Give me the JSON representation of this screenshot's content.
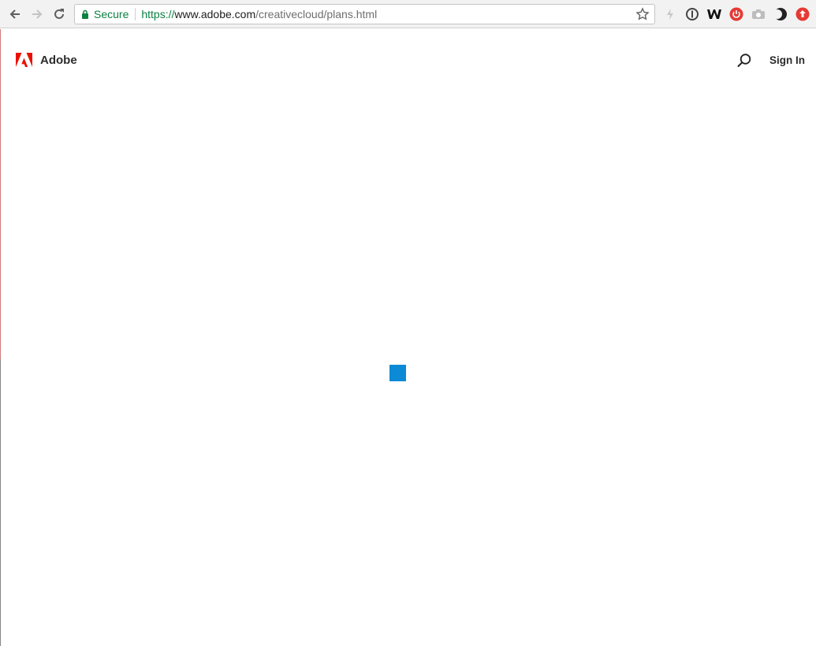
{
  "browser": {
    "secure_label": "Secure",
    "url": {
      "protocol": "https://",
      "host": "www.adobe.com",
      "path": "/creativecloud/plans.html"
    },
    "extensions": [
      "flash-icon",
      "onepassword-icon",
      "w-extension-icon",
      "power-extension-icon",
      "camera-icon",
      "dark-moon-icon",
      "upload-extension-icon"
    ]
  },
  "site": {
    "brand": "Adobe",
    "sign_in": "Sign In"
  },
  "colors": {
    "adobe_red": "#eb1000",
    "loader_blue": "#0d8ad6",
    "secure_green": "#0b8043"
  }
}
